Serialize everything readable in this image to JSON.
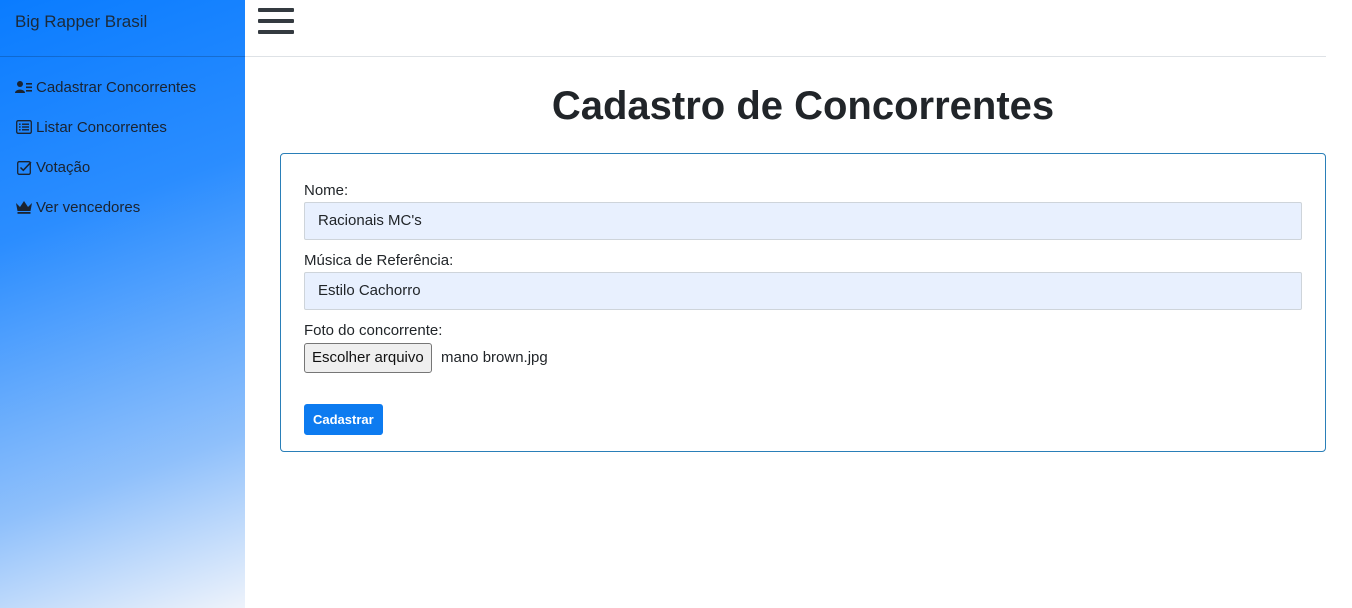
{
  "sidebar": {
    "brand": "Big Rapper Brasil",
    "items": [
      {
        "label": "Cadastrar Concorrentes",
        "icon": "user-list-icon"
      },
      {
        "label": "Listar Concorrentes",
        "icon": "list-icon"
      },
      {
        "label": "Votação",
        "icon": "check-square-icon"
      },
      {
        "label": "Ver vencedores",
        "icon": "crown-icon"
      }
    ]
  },
  "topbar": {
    "menu_icon": "hamburger-icon"
  },
  "main": {
    "title": "Cadastro de Concorrentes",
    "form": {
      "name_label": "Nome:",
      "name_value": "Racionais MC's",
      "song_label": "Música de Referência:",
      "song_value": "Estilo Cachorro",
      "photo_label": "Foto do concorrente:",
      "file_button": "Escolher arquivo",
      "file_name": "mano brown.jpg",
      "submit_label": "Cadastrar"
    }
  },
  "colors": {
    "accent": "#0d7bf0",
    "card_border": "#2a7fb8",
    "input_bg": "#e8f0fe"
  }
}
